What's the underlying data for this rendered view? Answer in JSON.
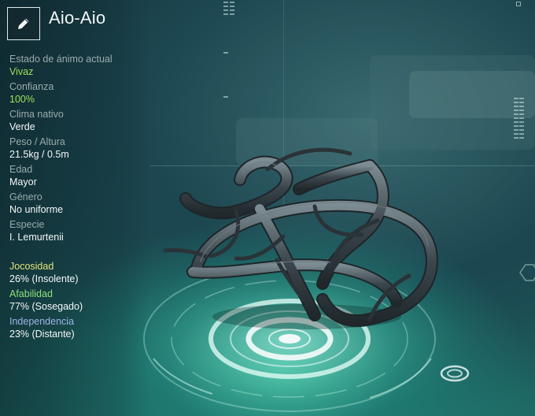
{
  "creature": {
    "name": "Aio-Aio"
  },
  "toolbar": {
    "edit_icon": "pencil-icon"
  },
  "stats": [
    {
      "label": "Estado de ánimo actual",
      "value": "Vivaz",
      "value_color": "#9de35a"
    },
    {
      "label": "Confianza",
      "value": "100%",
      "value_color": "#9de35a"
    },
    {
      "label": "Clima nativo",
      "value": "Verde",
      "value_color": "#f4f7f7"
    },
    {
      "label": "Peso / Altura",
      "value": "21.5kg / 0.5m",
      "value_color": "#f4f7f7"
    },
    {
      "label": "Edad",
      "value": "Mayor",
      "value_color": "#f4f7f7"
    },
    {
      "label": "Género",
      "value": "No uniforme",
      "value_color": "#f4f7f7"
    },
    {
      "label": "Especie",
      "value": "I. Lemurtenii",
      "value_color": "#f4f7f7"
    }
  ],
  "traits": [
    {
      "label": "Jocosidad",
      "value": "26% (Insolente)",
      "label_color": "#e6e27a"
    },
    {
      "label": "Afabilidad",
      "value": "77% (Sosegado)",
      "label_color": "#8fe07a"
    },
    {
      "label": "Independencia",
      "value": "23% (Distante)",
      "label_color": "#9fb4e6"
    }
  ]
}
